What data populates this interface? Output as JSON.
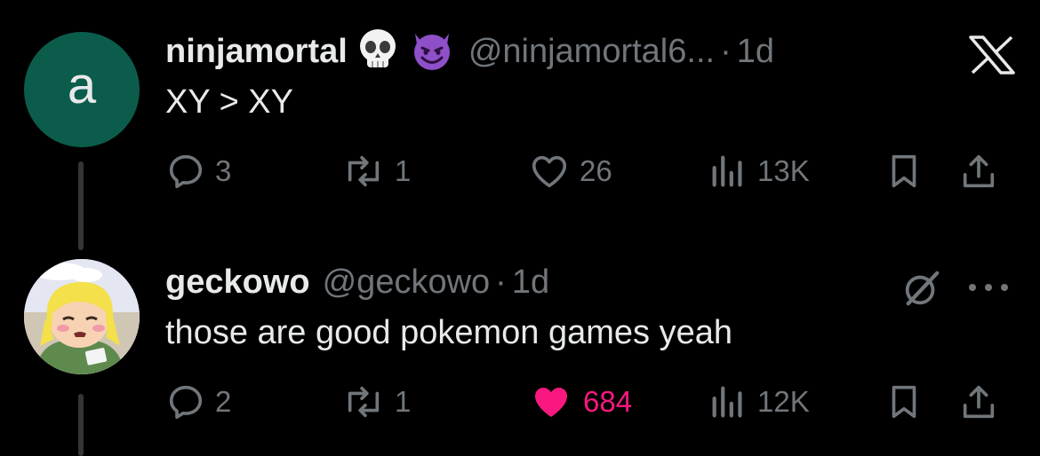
{
  "tweets": [
    {
      "avatar_letter": "a",
      "avatar_color": "#0c5c4c",
      "name": "ninjamortal",
      "name_emojis": [
        "skull-emoji",
        "smiling-imp-emoji"
      ],
      "handle": "@ninjamortal6...",
      "separator": "·",
      "time": "1d",
      "text": "XY > XY",
      "replies": "3",
      "reposts": "1",
      "likes": "26",
      "views": "13K",
      "liked": false
    },
    {
      "avatar_icon": "anime-character-avatar",
      "name": "geckowo",
      "handle": "@geckowo",
      "separator": "·",
      "time": "1d",
      "text": "those are good pokemon games yeah",
      "replies": "2",
      "reposts": "1",
      "likes": "684",
      "views": "12K",
      "liked": true
    }
  ],
  "colors": {
    "background": "#000000",
    "text_primary": "#e7e9ea",
    "text_secondary": "#71767b",
    "like_active": "#f91880",
    "thread_line": "#333639"
  },
  "icons": {
    "top_right_logo": "x-logo-icon",
    "grok_icon": "grok-icon",
    "more": "more-options-icon"
  }
}
